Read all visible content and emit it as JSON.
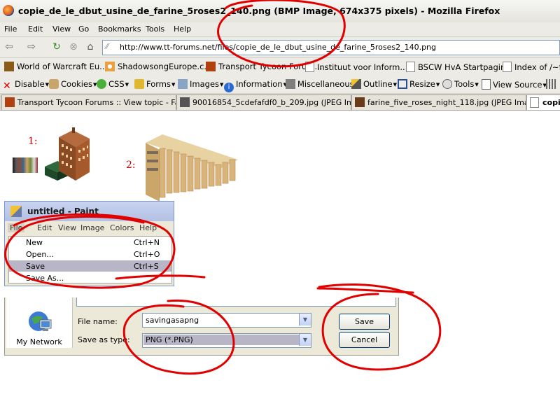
{
  "browser": {
    "window_title": "copie_de_le_dbut_usine_de_farine_5roses2_140.png (BMP Image, 674x375 pixels) - Mozilla Firefox",
    "menu": [
      "File",
      "Edit",
      "View",
      "Go",
      "Bookmarks",
      "Tools",
      "Help"
    ],
    "url": "http://www.tt-forums.net/files/copie_de_le_dbut_usine_de_farine_5roses2_140.png",
    "bookmarks": [
      "World of Warcraft Eu...",
      "ShadowsongEurope.c...",
      "Transport Tycoon Forum...",
      "Instituut voor Inform...",
      "BSCW HvA Startpagina",
      "Index of /~fe"
    ],
    "devtools": [
      "Disable",
      "Cookies",
      "CSS",
      "Forms",
      "Images",
      "Information",
      "Miscellaneous",
      "Outline",
      "Resize",
      "Tools",
      "View Source"
    ],
    "tabs": [
      "Transport Tycoon Forums :: View topic - Fa...",
      "90016854_5cdefafdf0_b_209.jpg (JPEG Im...",
      "farine_five_roses_night_118.jpg (JPEG Ima...",
      "copi"
    ]
  },
  "content": {
    "step1": "1:",
    "step2": "2:"
  },
  "paint": {
    "title": "untitled - Paint",
    "menu": [
      "File",
      "Edit",
      "View",
      "Image",
      "Colors",
      "Help"
    ],
    "file_menu": [
      {
        "label": "New",
        "shortcut": "Ctrl+N"
      },
      {
        "label": "Open...",
        "shortcut": "Ctrl+O"
      },
      {
        "label": "Save",
        "shortcut": "Ctrl+S"
      },
      {
        "label": "Save As...",
        "shortcut": ""
      }
    ]
  },
  "save_dialog": {
    "places_label": "My Network",
    "file_name_label": "File name:",
    "file_name_value": "savingasapng",
    "save_type_label": "Save as type:",
    "save_type_value": "PNG (*.PNG)",
    "save_button": "Save",
    "cancel_button": "Cancel"
  },
  "colors": {
    "annotation": "#e00000"
  }
}
